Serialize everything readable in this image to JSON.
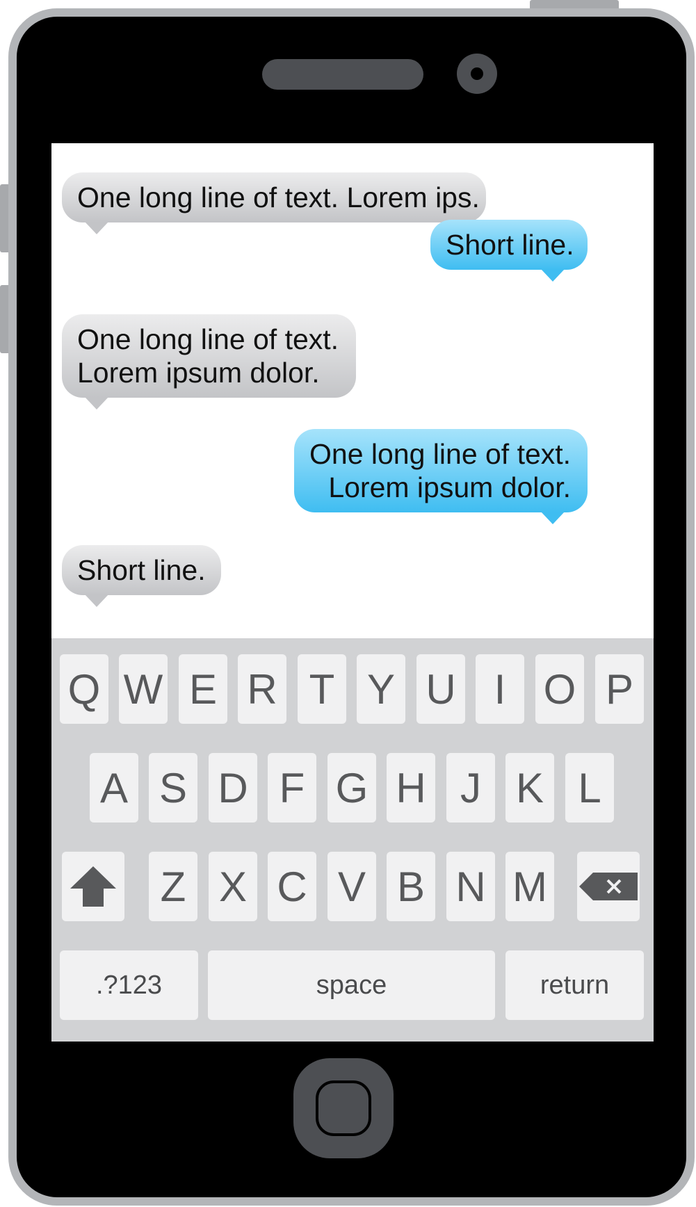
{
  "chat": {
    "messages": [
      {
        "side": "incoming",
        "lines": [
          "One long line of text. Lorem ips."
        ]
      },
      {
        "side": "outgoing",
        "lines": [
          "Short line."
        ]
      },
      {
        "side": "incoming",
        "lines": [
          "One long line of text.",
          "Lorem ipsum dolor."
        ]
      },
      {
        "side": "outgoing",
        "lines": [
          "One long line of text.",
          "Lorem ipsum dolor."
        ]
      },
      {
        "side": "incoming",
        "lines": [
          "Short line."
        ]
      }
    ],
    "colors": {
      "incoming_bubble": "#c3c4c7",
      "outgoing_bubble": "#3fbdf1"
    }
  },
  "keyboard": {
    "row1": [
      "Q",
      "W",
      "E",
      "R",
      "T",
      "Y",
      "U",
      "I",
      "O",
      "P"
    ],
    "row2": [
      "A",
      "S",
      "D",
      "F",
      "G",
      "H",
      "J",
      "K",
      "L"
    ],
    "row3": [
      "Z",
      "X",
      "C",
      "V",
      "B",
      "N",
      "M"
    ],
    "shift_icon": "shift-arrow-icon",
    "backspace_icon": "backspace-icon",
    "numbers_label": ".?123",
    "space_label": "space",
    "return_label": "return"
  },
  "device": {
    "frame_color": "#b3b5b8",
    "body_color": "#000000",
    "home_button_icon": "home-button-icon"
  }
}
